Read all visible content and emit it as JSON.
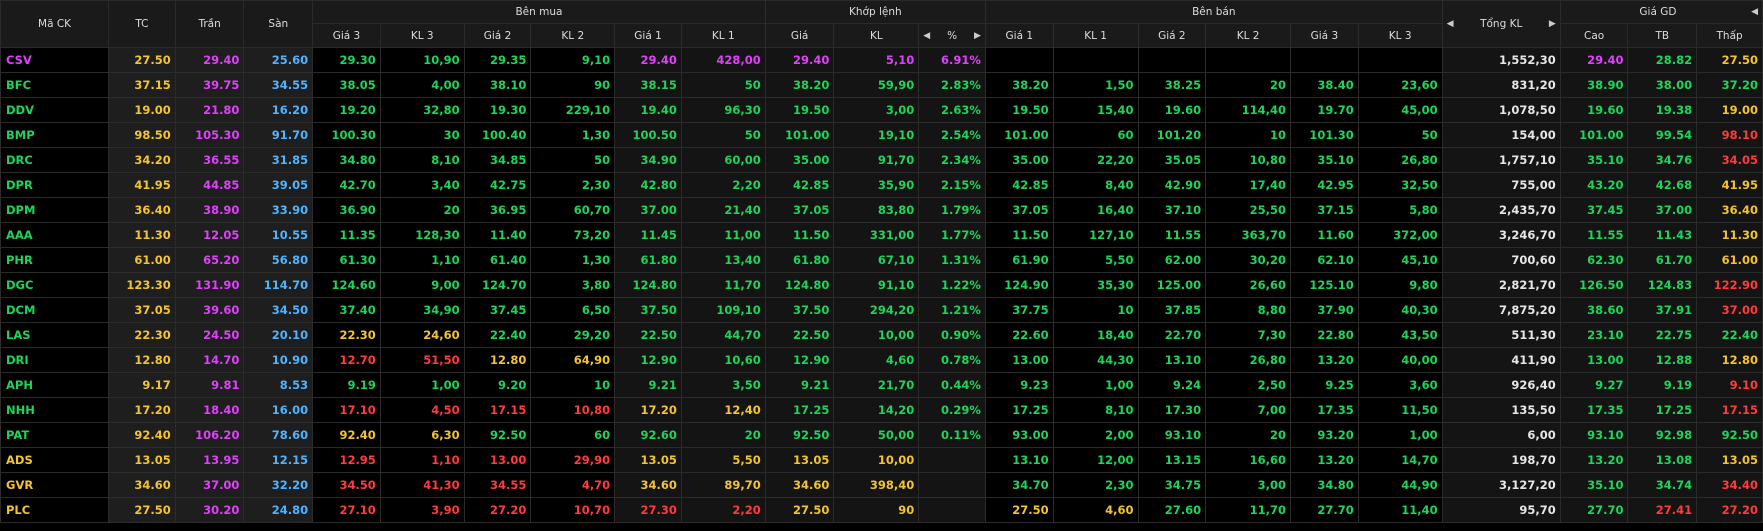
{
  "headers": {
    "symbol": "Mã CK",
    "ref": "TC",
    "ceil": "Trần",
    "floor": "Sàn",
    "buy_group": "Bên mua",
    "match_group": "Khớp lệnh",
    "sell_group": "Bên bán",
    "total": "Tổng KL",
    "price_group": "Giá GD",
    "buy": [
      "Giá 3",
      "KL 3",
      "Giá 2",
      "KL 2",
      "Giá 1",
      "KL 1"
    ],
    "match": [
      "Giá",
      "KL",
      "%"
    ],
    "sell": [
      "Giá 1",
      "KL 1",
      "Giá 2",
      "KL 2",
      "Giá 3",
      "KL 3"
    ],
    "price": [
      "Cao",
      "TB",
      "Thấp"
    ]
  },
  "colors": {
    "ceiling": "#e040fb",
    "up": "#1fd35b",
    "reference": "#f4c430",
    "down": "#ff3b3b",
    "floor": "#4fb3ff"
  },
  "rows": [
    {
      "sym": "CSV",
      "tc": "27.50",
      "tran": "29.40",
      "san": "25.60",
      "b": [
        "29.30",
        "10,90",
        "29.35",
        "9,10",
        "29.40",
        "428,00"
      ],
      "bc": [
        "u",
        "u",
        "u",
        "u",
        "c",
        "c"
      ],
      "m": [
        "29.40",
        "5,10",
        "6.91%"
      ],
      "mcc": "c",
      "s": [
        "",
        "",
        "",
        "",
        "",
        ""
      ],
      "sc": [
        "u",
        "u",
        "u",
        "u",
        "u",
        "u"
      ],
      "tot": "1,552,30",
      "p": [
        "29.40",
        "28.82",
        "27.50"
      ],
      "pc": [
        "c",
        "u",
        "r"
      ]
    },
    {
      "sym": "BFC",
      "tc": "37.15",
      "tran": "39.75",
      "san": "34.55",
      "b": [
        "38.05",
        "4,00",
        "38.10",
        "90",
        "38.15",
        "50"
      ],
      "bc": [
        "u",
        "u",
        "u",
        "u",
        "u",
        "u"
      ],
      "m": [
        "38.20",
        "59,90",
        "2.83%"
      ],
      "mcc": "u",
      "s": [
        "38.20",
        "1,50",
        "38.25",
        "20",
        "38.40",
        "23,60"
      ],
      "sc": [
        "u",
        "u",
        "u",
        "u",
        "u",
        "u"
      ],
      "tot": "831,20",
      "p": [
        "38.90",
        "38.00",
        "37.20"
      ],
      "pc": [
        "u",
        "u",
        "u"
      ]
    },
    {
      "sym": "DDV",
      "tc": "19.00",
      "tran": "21.80",
      "san": "16.20",
      "b": [
        "19.20",
        "32,80",
        "19.30",
        "229,10",
        "19.40",
        "96,30"
      ],
      "bc": [
        "u",
        "u",
        "u",
        "u",
        "u",
        "u"
      ],
      "m": [
        "19.50",
        "3,00",
        "2.63%"
      ],
      "mcc": "u",
      "s": [
        "19.50",
        "15,40",
        "19.60",
        "114,40",
        "19.70",
        "45,00"
      ],
      "sc": [
        "u",
        "u",
        "u",
        "u",
        "u",
        "u"
      ],
      "tot": "1,078,50",
      "p": [
        "19.60",
        "19.38",
        "19.00"
      ],
      "pc": [
        "u",
        "u",
        "r"
      ]
    },
    {
      "sym": "BMP",
      "tc": "98.50",
      "tran": "105.30",
      "san": "91.70",
      "b": [
        "100.30",
        "30",
        "100.40",
        "1,30",
        "100.50",
        "50"
      ],
      "bc": [
        "u",
        "u",
        "u",
        "u",
        "u",
        "u"
      ],
      "m": [
        "101.00",
        "19,10",
        "2.54%"
      ],
      "mcc": "u",
      "s": [
        "101.00",
        "60",
        "101.20",
        "10",
        "101.30",
        "50"
      ],
      "sc": [
        "u",
        "u",
        "u",
        "u",
        "u",
        "u"
      ],
      "tot": "154,00",
      "p": [
        "101.00",
        "99.54",
        "98.10"
      ],
      "pc": [
        "u",
        "u",
        "d"
      ]
    },
    {
      "sym": "DRC",
      "tc": "34.20",
      "tran": "36.55",
      "san": "31.85",
      "b": [
        "34.80",
        "8,10",
        "34.85",
        "50",
        "34.90",
        "60,00"
      ],
      "bc": [
        "u",
        "u",
        "u",
        "u",
        "u",
        "u"
      ],
      "m": [
        "35.00",
        "91,70",
        "2.34%"
      ],
      "mcc": "u",
      "s": [
        "35.00",
        "22,20",
        "35.05",
        "10,80",
        "35.10",
        "26,80"
      ],
      "sc": [
        "u",
        "u",
        "u",
        "u",
        "u",
        "u"
      ],
      "tot": "1,757,10",
      "p": [
        "35.10",
        "34.76",
        "34.05"
      ],
      "pc": [
        "u",
        "u",
        "d"
      ]
    },
    {
      "sym": "DPR",
      "tc": "41.95",
      "tran": "44.85",
      "san": "39.05",
      "b": [
        "42.70",
        "3,40",
        "42.75",
        "2,30",
        "42.80",
        "2,20"
      ],
      "bc": [
        "u",
        "u",
        "u",
        "u",
        "u",
        "u"
      ],
      "m": [
        "42.85",
        "35,90",
        "2.15%"
      ],
      "mcc": "u",
      "s": [
        "42.85",
        "8,40",
        "42.90",
        "17,40",
        "42.95",
        "32,50"
      ],
      "sc": [
        "u",
        "u",
        "u",
        "u",
        "u",
        "u"
      ],
      "tot": "755,00",
      "p": [
        "43.20",
        "42.68",
        "41.95"
      ],
      "pc": [
        "u",
        "u",
        "r"
      ]
    },
    {
      "sym": "DPM",
      "tc": "36.40",
      "tran": "38.90",
      "san": "33.90",
      "b": [
        "36.90",
        "20",
        "36.95",
        "60,70",
        "37.00",
        "21,40"
      ],
      "bc": [
        "u",
        "u",
        "u",
        "u",
        "u",
        "u"
      ],
      "m": [
        "37.05",
        "83,80",
        "1.79%"
      ],
      "mcc": "u",
      "s": [
        "37.05",
        "16,40",
        "37.10",
        "25,50",
        "37.15",
        "5,80"
      ],
      "sc": [
        "u",
        "u",
        "u",
        "u",
        "u",
        "u"
      ],
      "tot": "2,435,70",
      "p": [
        "37.45",
        "37.00",
        "36.40"
      ],
      "pc": [
        "u",
        "u",
        "r"
      ]
    },
    {
      "sym": "AAA",
      "tc": "11.30",
      "tran": "12.05",
      "san": "10.55",
      "b": [
        "11.35",
        "128,30",
        "11.40",
        "73,20",
        "11.45",
        "11,00"
      ],
      "bc": [
        "u",
        "u",
        "u",
        "u",
        "u",
        "u"
      ],
      "m": [
        "11.50",
        "331,00",
        "1.77%"
      ],
      "mcc": "u",
      "s": [
        "11.50",
        "127,10",
        "11.55",
        "363,70",
        "11.60",
        "372,00"
      ],
      "sc": [
        "u",
        "u",
        "u",
        "u",
        "u",
        "u"
      ],
      "tot": "3,246,70",
      "p": [
        "11.55",
        "11.43",
        "11.30"
      ],
      "pc": [
        "u",
        "u",
        "r"
      ]
    },
    {
      "sym": "PHR",
      "tc": "61.00",
      "tran": "65.20",
      "san": "56.80",
      "b": [
        "61.30",
        "1,10",
        "61.40",
        "1,30",
        "61.80",
        "13,40"
      ],
      "bc": [
        "u",
        "u",
        "u",
        "u",
        "u",
        "u"
      ],
      "m": [
        "61.80",
        "67,10",
        "1.31%"
      ],
      "mcc": "u",
      "s": [
        "61.90",
        "5,50",
        "62.00",
        "30,20",
        "62.10",
        "45,10"
      ],
      "sc": [
        "u",
        "u",
        "u",
        "u",
        "u",
        "u"
      ],
      "tot": "700,60",
      "p": [
        "62.30",
        "61.70",
        "61.00"
      ],
      "pc": [
        "u",
        "u",
        "r"
      ]
    },
    {
      "sym": "DGC",
      "tc": "123.30",
      "tran": "131.90",
      "san": "114.70",
      "b": [
        "124.60",
        "9,00",
        "124.70",
        "3,80",
        "124.80",
        "11,70"
      ],
      "bc": [
        "u",
        "u",
        "u",
        "u",
        "u",
        "u"
      ],
      "m": [
        "124.80",
        "91,10",
        "1.22%"
      ],
      "mcc": "u",
      "s": [
        "124.90",
        "35,30",
        "125.00",
        "26,60",
        "125.10",
        "9,80"
      ],
      "sc": [
        "u",
        "u",
        "u",
        "u",
        "u",
        "u"
      ],
      "tot": "2,821,70",
      "p": [
        "126.50",
        "124.83",
        "122.90"
      ],
      "pc": [
        "u",
        "u",
        "d"
      ]
    },
    {
      "sym": "DCM",
      "tc": "37.05",
      "tran": "39.60",
      "san": "34.50",
      "b": [
        "37.40",
        "34,90",
        "37.45",
        "6,50",
        "37.50",
        "109,10"
      ],
      "bc": [
        "u",
        "u",
        "u",
        "u",
        "u",
        "u"
      ],
      "m": [
        "37.50",
        "294,20",
        "1.21%"
      ],
      "mcc": "u",
      "s": [
        "37.75",
        "10",
        "37.85",
        "8,80",
        "37.90",
        "40,30"
      ],
      "sc": [
        "u",
        "u",
        "u",
        "u",
        "u",
        "u"
      ],
      "tot": "7,875,20",
      "p": [
        "38.60",
        "37.91",
        "37.00"
      ],
      "pc": [
        "u",
        "u",
        "d"
      ]
    },
    {
      "sym": "LAS",
      "tc": "22.30",
      "tran": "24.50",
      "san": "20.10",
      "b": [
        "22.30",
        "24,60",
        "22.40",
        "29,20",
        "22.50",
        "44,70"
      ],
      "bc": [
        "r",
        "r",
        "u",
        "u",
        "u",
        "u"
      ],
      "m": [
        "22.50",
        "10,00",
        "0.90%"
      ],
      "mcc": "u",
      "s": [
        "22.60",
        "18,40",
        "22.70",
        "7,30",
        "22.80",
        "43,50"
      ],
      "sc": [
        "u",
        "u",
        "u",
        "u",
        "u",
        "u"
      ],
      "tot": "511,30",
      "p": [
        "23.10",
        "22.75",
        "22.40"
      ],
      "pc": [
        "u",
        "u",
        "u"
      ]
    },
    {
      "sym": "DRI",
      "tc": "12.80",
      "tran": "14.70",
      "san": "10.90",
      "b": [
        "12.70",
        "51,50",
        "12.80",
        "64,90",
        "12.90",
        "10,60"
      ],
      "bc": [
        "d",
        "d",
        "r",
        "r",
        "u",
        "u"
      ],
      "m": [
        "12.90",
        "4,60",
        "0.78%"
      ],
      "mcc": "u",
      "s": [
        "13.00",
        "44,30",
        "13.10",
        "26,80",
        "13.20",
        "40,00"
      ],
      "sc": [
        "u",
        "u",
        "u",
        "u",
        "u",
        "u"
      ],
      "tot": "411,90",
      "p": [
        "13.00",
        "12.88",
        "12.80"
      ],
      "pc": [
        "u",
        "u",
        "r"
      ]
    },
    {
      "sym": "APH",
      "tc": "9.17",
      "tran": "9.81",
      "san": "8.53",
      "b": [
        "9.19",
        "1,00",
        "9.20",
        "10",
        "9.21",
        "3,50"
      ],
      "bc": [
        "u",
        "u",
        "u",
        "u",
        "u",
        "u"
      ],
      "m": [
        "9.21",
        "21,70",
        "0.44%"
      ],
      "mcc": "u",
      "s": [
        "9.23",
        "1,00",
        "9.24",
        "2,50",
        "9.25",
        "3,60"
      ],
      "sc": [
        "u",
        "u",
        "u",
        "u",
        "u",
        "u"
      ],
      "tot": "926,40",
      "p": [
        "9.27",
        "9.19",
        "9.10"
      ],
      "pc": [
        "u",
        "u",
        "d"
      ]
    },
    {
      "sym": "NHH",
      "tc": "17.20",
      "tran": "18.40",
      "san": "16.00",
      "b": [
        "17.10",
        "4,50",
        "17.15",
        "10,80",
        "17.20",
        "12,40"
      ],
      "bc": [
        "d",
        "d",
        "d",
        "d",
        "r",
        "r"
      ],
      "m": [
        "17.25",
        "14,20",
        "0.29%"
      ],
      "mcc": "u",
      "s": [
        "17.25",
        "8,10",
        "17.30",
        "7,00",
        "17.35",
        "11,50"
      ],
      "sc": [
        "u",
        "u",
        "u",
        "u",
        "u",
        "u"
      ],
      "tot": "135,50",
      "p": [
        "17.35",
        "17.25",
        "17.15"
      ],
      "pc": [
        "u",
        "u",
        "d"
      ]
    },
    {
      "sym": "PAT",
      "tc": "92.40",
      "tran": "106.20",
      "san": "78.60",
      "b": [
        "92.40",
        "6,30",
        "92.50",
        "60",
        "92.60",
        "20"
      ],
      "bc": [
        "r",
        "r",
        "u",
        "u",
        "u",
        "u"
      ],
      "m": [
        "92.50",
        "50,00",
        "0.11%"
      ],
      "mcc": "u",
      "s": [
        "93.00",
        "2,00",
        "93.10",
        "20",
        "93.20",
        "1,00"
      ],
      "sc": [
        "u",
        "u",
        "u",
        "u",
        "u",
        "u"
      ],
      "tot": "6,00",
      "p": [
        "93.10",
        "92.98",
        "92.50"
      ],
      "pc": [
        "u",
        "u",
        "u"
      ]
    },
    {
      "sym": "ADS",
      "tc": "13.05",
      "tran": "13.95",
      "san": "12.15",
      "b": [
        "12.95",
        "1,10",
        "13.00",
        "29,90",
        "13.05",
        "5,50"
      ],
      "bc": [
        "d",
        "d",
        "d",
        "d",
        "r",
        "r"
      ],
      "m": [
        "13.05",
        "10,00",
        ""
      ],
      "mcc": "r",
      "s": [
        "13.10",
        "12,00",
        "13.15",
        "16,60",
        "13.20",
        "14,70"
      ],
      "sc": [
        "u",
        "u",
        "u",
        "u",
        "u",
        "u"
      ],
      "tot": "198,70",
      "p": [
        "13.20",
        "13.08",
        "13.05"
      ],
      "pc": [
        "u",
        "u",
        "r"
      ]
    },
    {
      "sym": "GVR",
      "tc": "34.60",
      "tran": "37.00",
      "san": "32.20",
      "b": [
        "34.50",
        "41,30",
        "34.55",
        "4,70",
        "34.60",
        "89,70"
      ],
      "bc": [
        "d",
        "d",
        "d",
        "d",
        "r",
        "r"
      ],
      "m": [
        "34.60",
        "398,40",
        ""
      ],
      "mcc": "r",
      "s": [
        "34.70",
        "2,30",
        "34.75",
        "3,00",
        "34.80",
        "44,90"
      ],
      "sc": [
        "u",
        "u",
        "u",
        "u",
        "u",
        "u"
      ],
      "tot": "3,127,20",
      "p": [
        "35.10",
        "34.74",
        "34.40"
      ],
      "pc": [
        "u",
        "u",
        "d"
      ]
    },
    {
      "sym": "PLC",
      "tc": "27.50",
      "tran": "30.20",
      "san": "24.80",
      "b": [
        "27.10",
        "3,90",
        "27.20",
        "10,70",
        "27.30",
        "2,20"
      ],
      "bc": [
        "d",
        "d",
        "d",
        "d",
        "d",
        "d"
      ],
      "m": [
        "27.50",
        "90",
        ""
      ],
      "mcc": "r",
      "s": [
        "27.50",
        "4,60",
        "27.60",
        "11,70",
        "27.70",
        "11,40"
      ],
      "sc": [
        "r",
        "r",
        "u",
        "u",
        "u",
        "u"
      ],
      "tot": "95,70",
      "p": [
        "27.70",
        "27.41",
        "27.20"
      ],
      "pc": [
        "u",
        "d",
        "d"
      ]
    }
  ]
}
